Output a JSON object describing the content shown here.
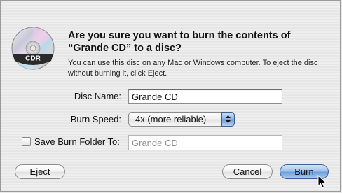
{
  "dialog": {
    "title": "Are you sure you want to burn the contents of “Grande CD” to a disc?",
    "message": "You can use this disc on any Mac or Windows computer. To eject the disc without burning it, click Eject.",
    "icon": "cdr-disc-icon",
    "icon_label": "CDR"
  },
  "form": {
    "disc_name_label": "Disc Name:",
    "disc_name_value": "Grande CD",
    "burn_speed_label": "Burn Speed:",
    "burn_speed_value": "4x (more reliable)",
    "save_folder_label": "Save Burn Folder To:",
    "save_folder_value": "Grande CD",
    "save_folder_checked": false
  },
  "buttons": {
    "eject": "Eject",
    "cancel": "Cancel",
    "burn": "Burn"
  },
  "colors": {
    "default_button": "#7aa7e0",
    "background": "#ececec"
  }
}
